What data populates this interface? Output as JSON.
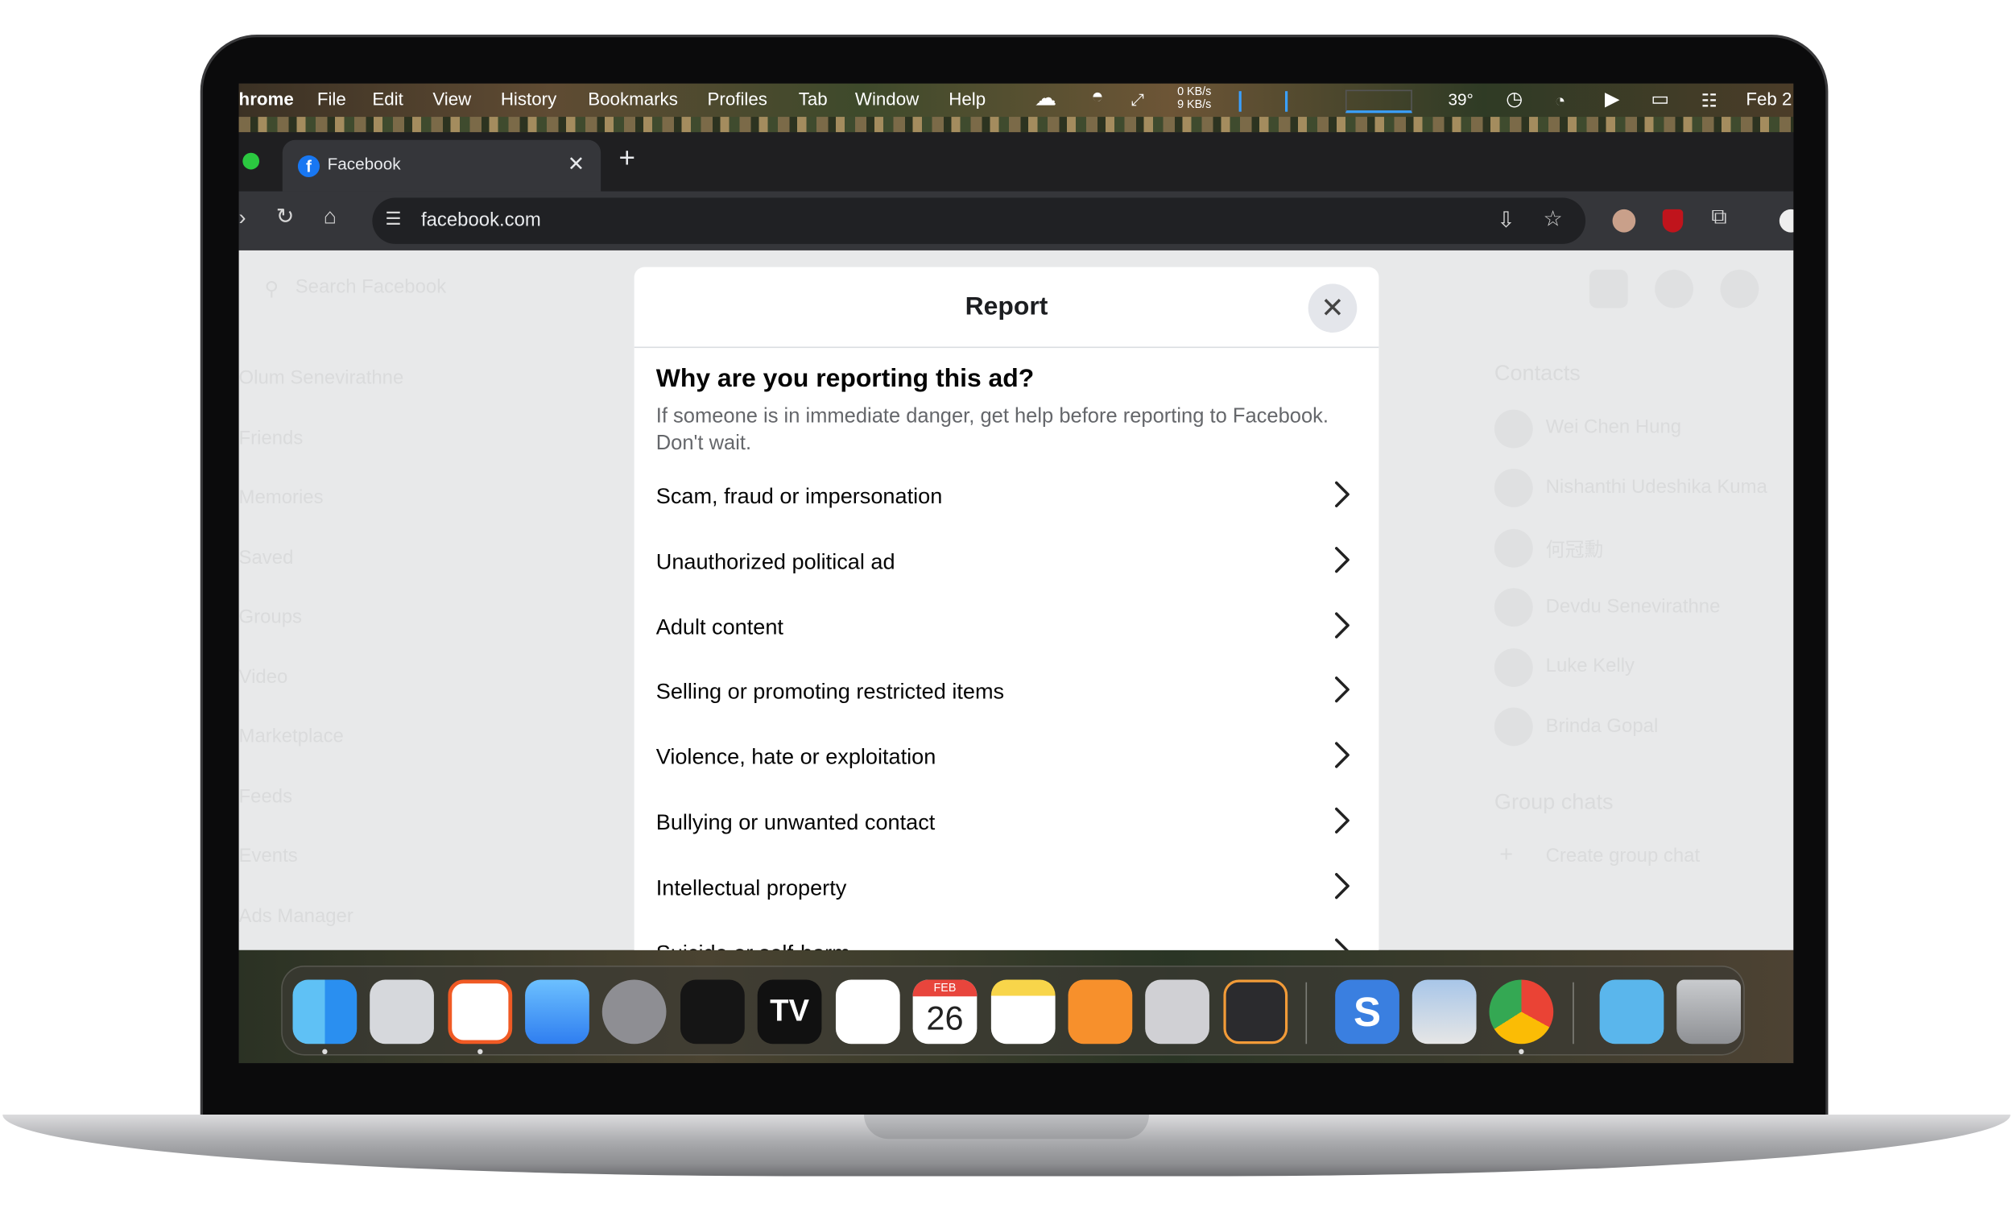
{
  "menubar": {
    "app": "hrome",
    "menus": [
      "File",
      "Edit",
      "View",
      "History",
      "Bookmarks",
      "Profiles",
      "Tab",
      "Window",
      "Help"
    ],
    "net_up": "0 KB/s",
    "net_down": "9 KB/s",
    "temp": "39°",
    "date": "Feb 2"
  },
  "browser": {
    "tab_title": "Facebook",
    "favicon_letter": "f",
    "url": "facebook.com",
    "new_tab": "+",
    "tab_close": "✕"
  },
  "background": {
    "search_placeholder": "Search Facebook",
    "sidebar": [
      "Olum Senevirathne",
      "Friends",
      "Memories",
      "Saved",
      "Groups",
      "Video",
      "Marketplace",
      "Feeds",
      "Events",
      "Ads Manager"
    ],
    "contacts_title": "Contacts",
    "contacts": [
      "Wei Chen Hung",
      "Nishanthi Udeshika Kuma",
      "何冠勳",
      "Devdu Senevirathne",
      "Luke Kelly",
      "Brinda Gopal"
    ],
    "group_chats_title": "Group chats",
    "create_group": "Create group chat"
  },
  "modal": {
    "title": "Report",
    "question": "Why are you reporting this ad?",
    "subtitle": "If someone is in immediate danger, get help before reporting to Facebook. Don't wait.",
    "options": [
      "Scam, fraud or impersonation",
      "Unauthorized political ad",
      "Adult content",
      "Selling or promoting restricted items",
      "Violence, hate or exploitation",
      "Bullying or unwanted contact",
      "Intellectual property",
      "Suicide or self-harm"
    ]
  },
  "dock": {
    "calendar_month": "FEB",
    "calendar_day": "26"
  }
}
